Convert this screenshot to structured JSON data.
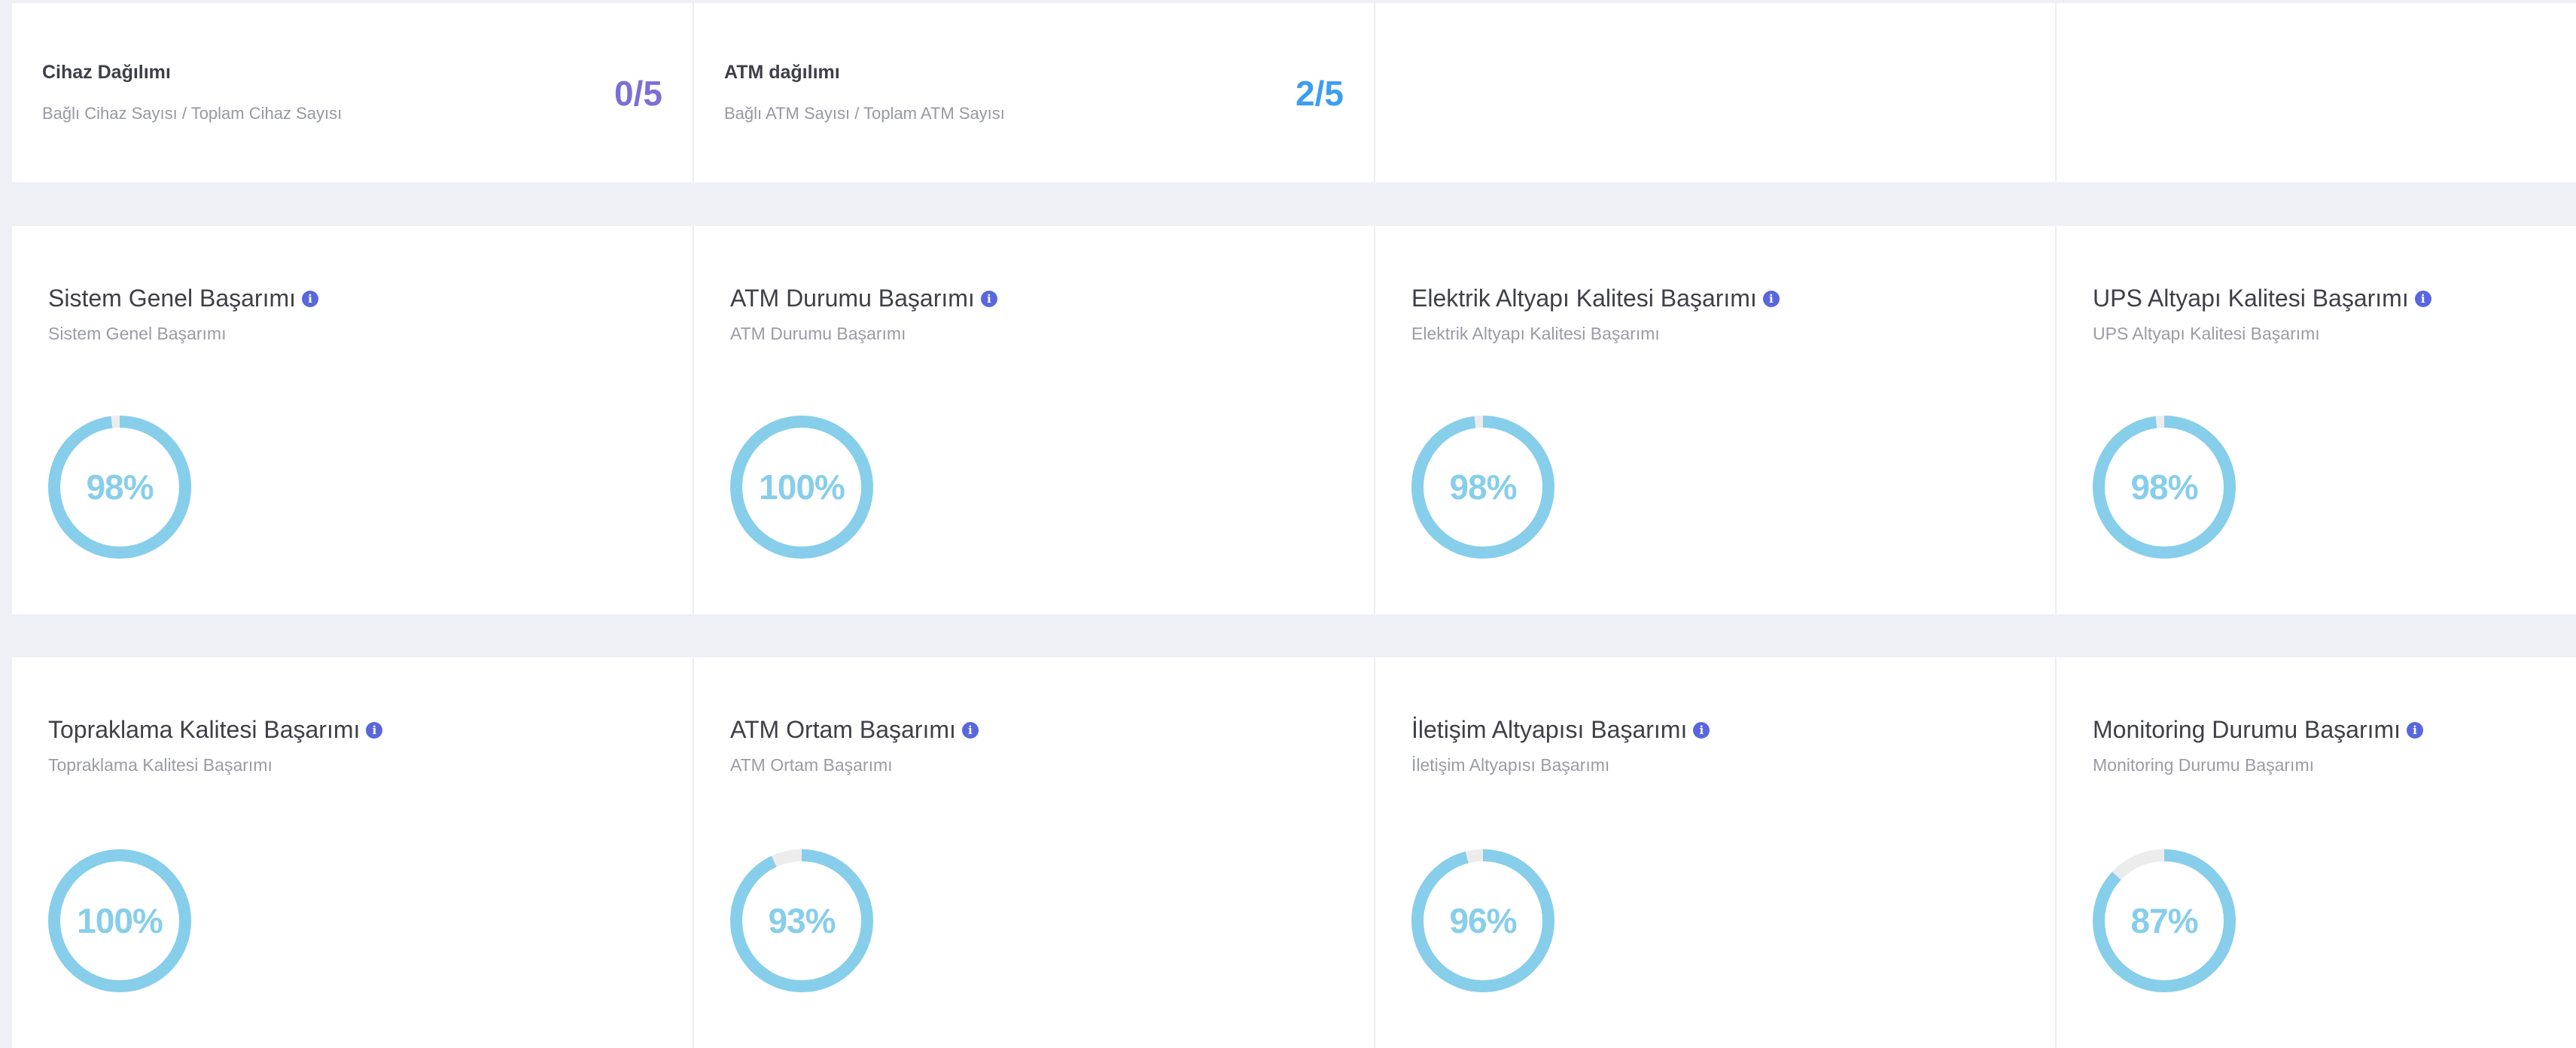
{
  "stats": [
    {
      "title": "Cihaz Dağılımı",
      "subtitle": "Bağlı Cihaz Sayısı / Toplam Cihaz Sayısı",
      "value": "0/5",
      "color": "#7b6fd6"
    },
    {
      "title": "ATM dağılımı",
      "subtitle": "Bağlı ATM Sayısı / Toplam ATM Sayısı",
      "value": "2/5",
      "color": "#3d9ef0"
    }
  ],
  "performance": [
    {
      "title": "Sistem Genel Başarımı",
      "subtitle": "Sistem Genel Başarımı",
      "percent": 98,
      "label": "98%"
    },
    {
      "title": "ATM Durumu Başarımı",
      "subtitle": "ATM Durumu Başarımı",
      "percent": 100,
      "label": "100%"
    },
    {
      "title": "Elektrik Altyapı Kalitesi Başarımı",
      "subtitle": "Elektrik Altyapı Kalitesi Başarımı",
      "percent": 98,
      "label": "98%"
    },
    {
      "title": "UPS Altyapı Kalitesi Başarımı",
      "subtitle": "UPS Altyapı Kalitesi Başarımı",
      "percent": 98,
      "label": "98%"
    },
    {
      "title": "Topraklama Kalitesi Başarımı",
      "subtitle": "Topraklama Kalitesi Başarımı",
      "percent": 100,
      "label": "100%"
    },
    {
      "title": "ATM Ortam Başarımı",
      "subtitle": "ATM Ortam Başarımı",
      "percent": 93,
      "label": "93%"
    },
    {
      "title": "İletişim Altyapısı Başarımı",
      "subtitle": "İletişim Altyapısı Başarımı",
      "percent": 96,
      "label": "96%"
    },
    {
      "title": "Monitoring Durumu Başarımı",
      "subtitle": "Monitoring Durumu Başarımı",
      "percent": 87,
      "label": "87%"
    }
  ],
  "colors": {
    "ring_fill": "#87ceeb",
    "ring_track": "#ececec",
    "info_icon": "#5867dd"
  },
  "icons": {
    "info": "info-icon"
  }
}
